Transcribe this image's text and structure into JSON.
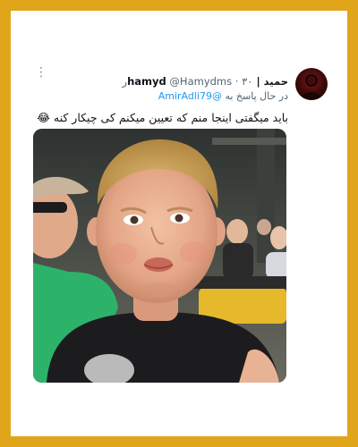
{
  "tweet": {
    "author_name": "حمید | hamyd",
    "handle": "@Hamydms",
    "separator": "·",
    "time": "۳۰ر",
    "reply_prefix": "در حال پاسخ به",
    "reply_to": "@AmirAdli79",
    "text": "باید میگفتی اینجا منم که تعیین میکنم کی چیکار کنه",
    "emoji": "😂",
    "more_icon": "⋮"
  },
  "colors": {
    "frame": "#e0a51a",
    "name": "#0f1419",
    "meta": "#536471",
    "mention": "#1d9bf0"
  },
  "icons": {
    "more": "more-vertical-icon",
    "avatar": "avatar-image"
  },
  "media": {
    "alt": "boy-selfie-photo"
  }
}
